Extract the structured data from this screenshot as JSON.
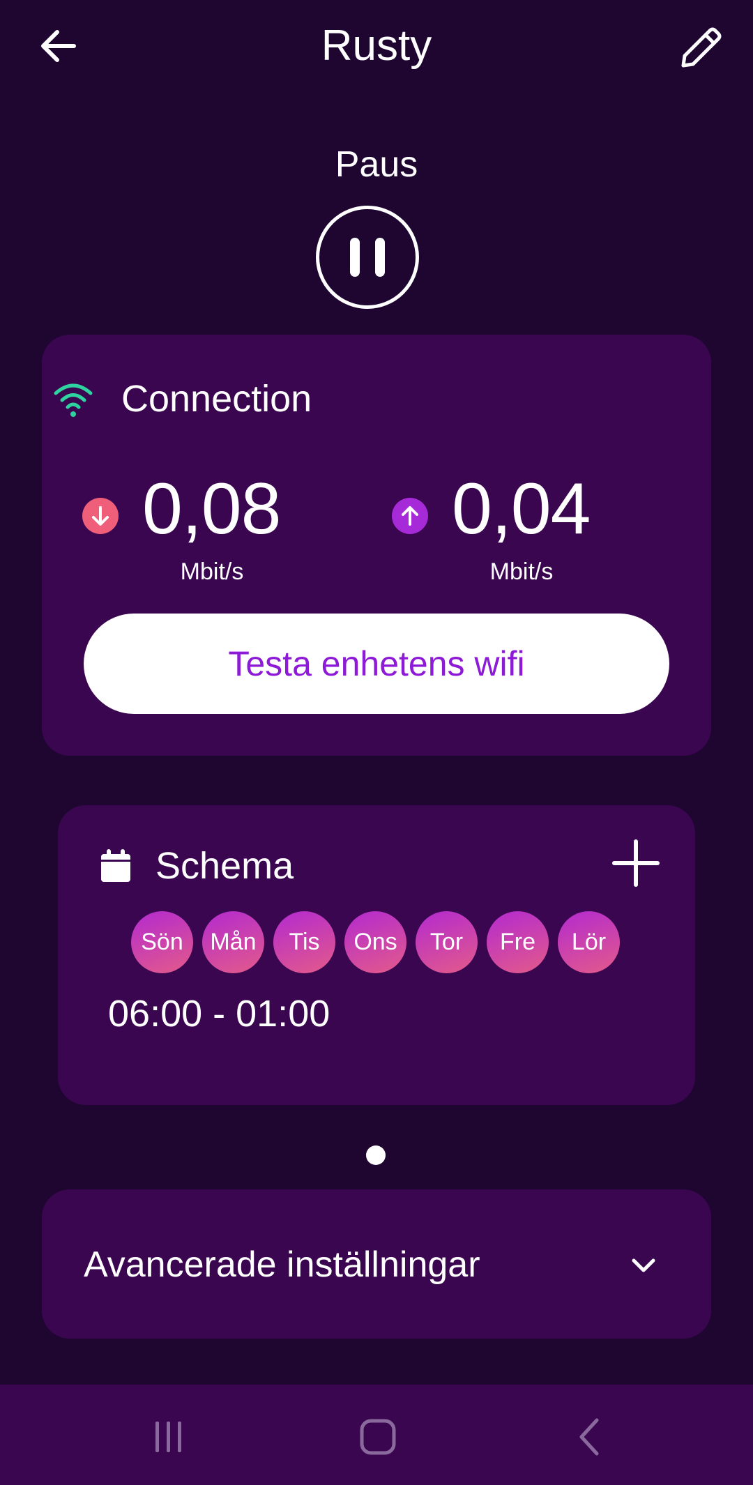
{
  "header": {
    "title": "Rusty",
    "back_icon": "arrow-left-icon",
    "edit_icon": "pencil-icon"
  },
  "pause": {
    "label": "Paus",
    "icon": "pause-icon"
  },
  "connection": {
    "title": "Connection",
    "icon": "wifi-icon",
    "download": {
      "value": "0,08",
      "unit": "Mbit/s",
      "icon": "arrow-down-icon",
      "color": "#ef5f7a"
    },
    "upload": {
      "value": "0,04",
      "unit": "Mbit/s",
      "icon": "arrow-up-icon",
      "color": "#a62ad8"
    },
    "test_button_label": "Testa enhetens wifi"
  },
  "schedule": {
    "title": "Schema",
    "icon": "calendar-icon",
    "add_icon": "plus-icon",
    "days": [
      "Sön",
      "Mån",
      "Tis",
      "Ons",
      "Tor",
      "Fre",
      "Lör"
    ],
    "time_range": "06:00 - 01:00"
  },
  "advanced": {
    "label": "Avancerade inställningar",
    "icon": "chevron-down-icon"
  },
  "colors": {
    "background": "#1f0631",
    "card": "#3a0650",
    "accent": "#8c1ad6",
    "wifi_icon": "#2fd3a0"
  },
  "navbar": {
    "recents_icon": "recent-apps-icon",
    "home_icon": "home-icon",
    "back_icon": "back-chevron-icon"
  }
}
